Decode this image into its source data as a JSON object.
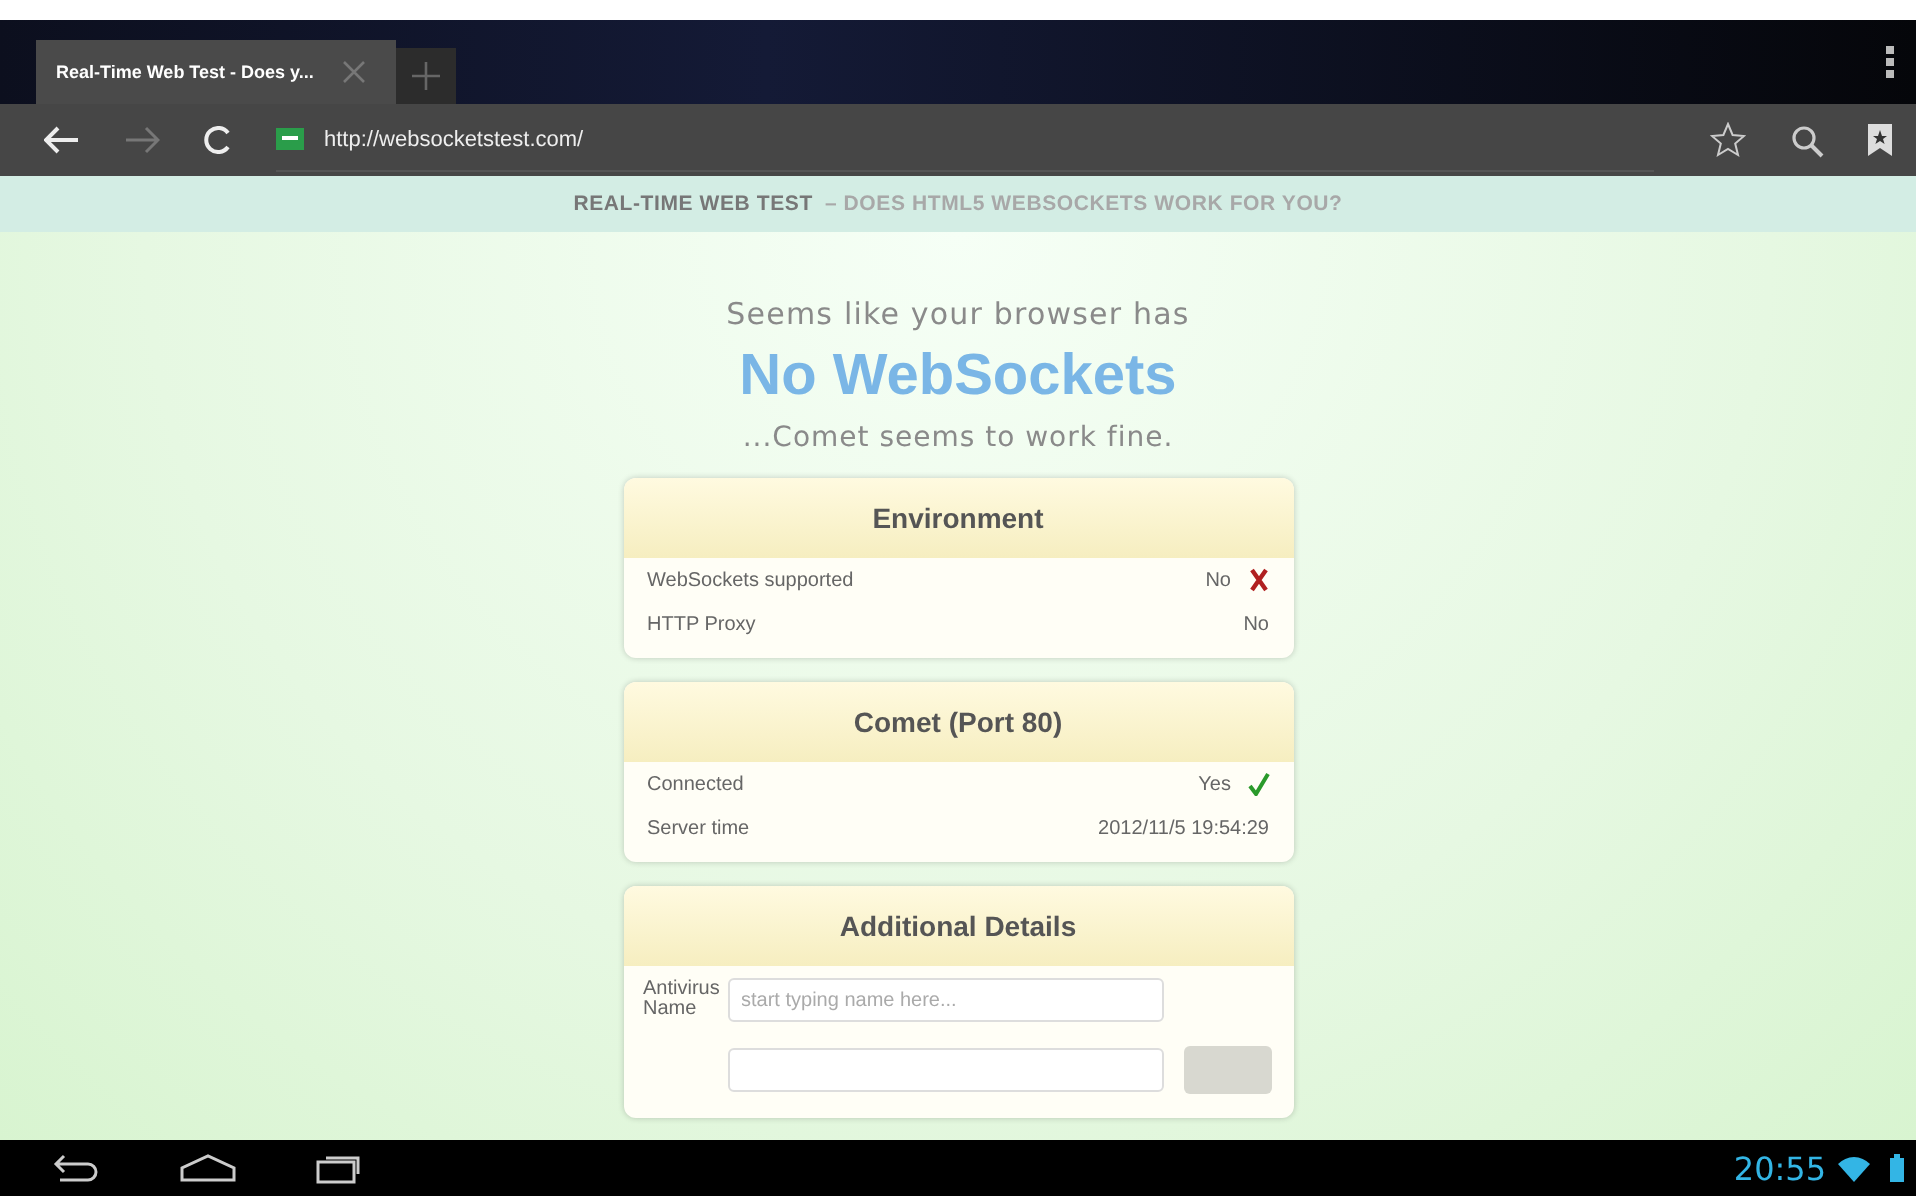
{
  "browser": {
    "tabs": [
      {
        "title": "Real-Time Web Test - Does y...",
        "selected": true
      }
    ],
    "url": "http://websocketstest.com/"
  },
  "page": {
    "banner": {
      "main": "REAL-TIME WEB TEST",
      "rest": "– DOES HTML5 WEBSOCKETS WORK FOR YOU?"
    },
    "intro": "Seems like your browser has",
    "headline": "No WebSockets",
    "subline": "...Comet seems to work fine.",
    "cards": [
      {
        "title": "Environment",
        "rows": [
          {
            "label": "WebSockets supported",
            "value": "No",
            "kind": "fail"
          },
          {
            "label": "HTTP Proxy",
            "value": "No",
            "kind": "plain"
          }
        ]
      },
      {
        "title": "Comet (Port 80)",
        "rows": [
          {
            "label": "Connected",
            "value": "Yes",
            "kind": "ok"
          },
          {
            "label": "Server time",
            "value": "2012/11/5 19:54:29",
            "kind": "plain"
          }
        ]
      }
    ],
    "details": {
      "title": "Additional Details",
      "fields": [
        {
          "label": "Antivirus Name",
          "placeholder": "start typing name here..."
        }
      ]
    }
  },
  "status_bar": {
    "time": "20:55"
  }
}
